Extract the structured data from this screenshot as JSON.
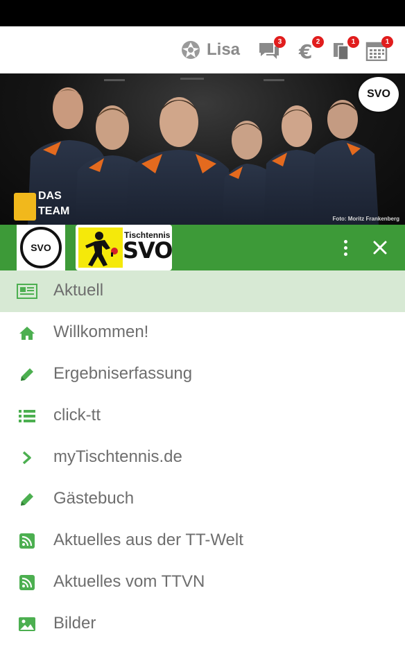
{
  "header": {
    "user_name": "Lisa",
    "icons": [
      {
        "name": "chat-icon",
        "badge": "3"
      },
      {
        "name": "euro-icon",
        "badge": "2"
      },
      {
        "name": "documents-icon",
        "badge": "1"
      },
      {
        "name": "calendar-icon",
        "badge": "1"
      }
    ]
  },
  "banner": {
    "corner_logo_text": "SVO",
    "team_label_line1": "DAS",
    "team_label_line2": "TEAM",
    "photo_credit": "Foto: Moritz Frankenberg"
  },
  "club_bar": {
    "logo_text": "SVO",
    "tt_logo_small": "Tischtennis",
    "tt_logo_big": "SVO"
  },
  "menu": {
    "items": [
      {
        "label": "Aktuell",
        "icon": "newspaper-icon",
        "active": true
      },
      {
        "label": "Willkommen!",
        "icon": "home-icon",
        "active": false
      },
      {
        "label": "Ergebniserfassung",
        "icon": "pencil-icon",
        "active": false
      },
      {
        "label": "click-tt",
        "icon": "list-icon",
        "active": false
      },
      {
        "label": "myTischtennis.de",
        "icon": "chevron-right-icon",
        "active": false
      },
      {
        "label": "Gästebuch",
        "icon": "pencil-icon",
        "active": false
      },
      {
        "label": "Aktuelles aus der TT-Welt",
        "icon": "rss-icon",
        "active": false
      },
      {
        "label": "Aktuelles vom TTVN",
        "icon": "rss-icon",
        "active": false
      },
      {
        "label": "Bilder",
        "icon": "image-icon",
        "active": false
      }
    ]
  },
  "colors": {
    "primary_green": "#3d9a38",
    "active_item_bg": "#d7e9d4",
    "icon_green": "#4caf50",
    "badge_red": "#e11d1d"
  }
}
